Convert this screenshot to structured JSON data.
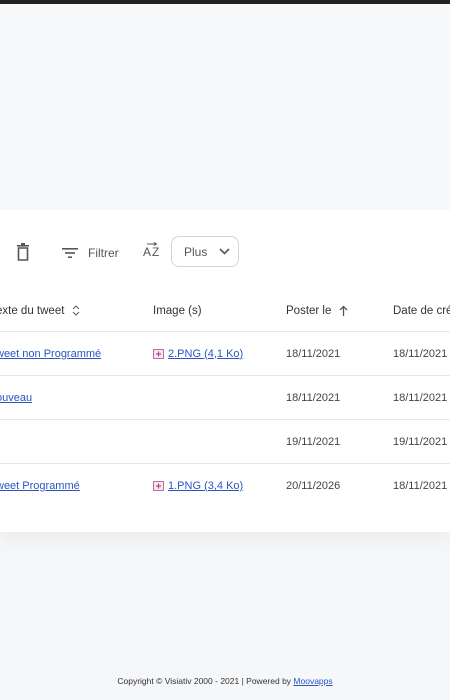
{
  "toolbar": {
    "filter_label": "Filtrer",
    "sort_label": "AZ",
    "more_label": "Plus",
    "icons": [
      "trash-icon",
      "filter-icon",
      "sort-az-icon",
      "chevron-down-icon"
    ]
  },
  "table": {
    "columns": [
      {
        "label": "exte du tweet",
        "sort": "sortable"
      },
      {
        "label": "Image (s)",
        "sort": null
      },
      {
        "label": "Poster le",
        "sort": "ascending"
      },
      {
        "label": "Date de créa",
        "sort": null
      }
    ],
    "rows": [
      {
        "text": "weet non Programmé",
        "image": "2.PNG (4,1 Ko)",
        "posted": "18/11/2021",
        "created": "18/11/2021"
      },
      {
        "text": "ouveau",
        "image": "",
        "posted": "18/11/2021",
        "created": "18/11/2021"
      },
      {
        "text": "",
        "image": "",
        "posted": "19/11/2021",
        "created": "19/11/2021"
      },
      {
        "text": "weet Programmé",
        "image": "1.PNG (3,4 Ko)",
        "posted": "20/11/2026",
        "created": "18/11/2021"
      }
    ]
  },
  "footer": {
    "copyright": "Copyright © Visiativ 2000 - 2021 | Powered by ",
    "brand": "Moovapps"
  },
  "colors": {
    "link": "#2a55c3",
    "background": "#f6f7f9",
    "card": "#ffffff"
  }
}
